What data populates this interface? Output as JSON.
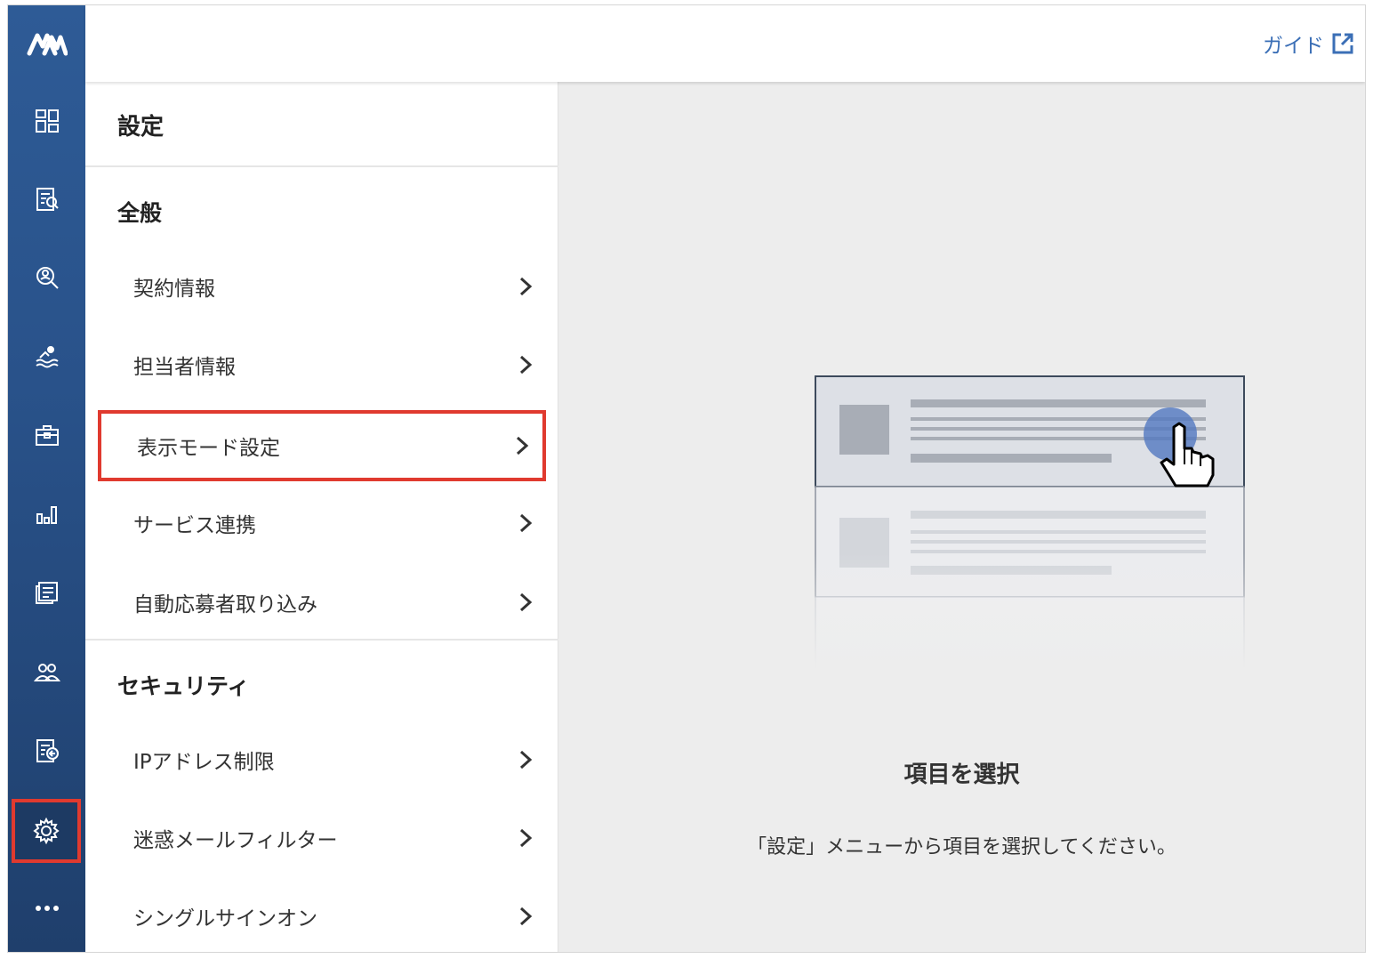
{
  "app": {
    "logo": "M",
    "colors": {
      "rail": "#2c5792",
      "accent": "#3b6fb6",
      "highlight": "#e03a2f"
    }
  },
  "header": {
    "guide_label": "ガイド",
    "guide_icon": "external-link-icon"
  },
  "rail": {
    "icons": [
      "dashboard-icon",
      "document-search-icon",
      "person-search-icon",
      "swimmer-icon",
      "briefcase-icon",
      "bar-chart-icon",
      "report-icon",
      "users-icon",
      "document-share-icon",
      "gear-icon",
      "more-icon"
    ]
  },
  "menu": {
    "title": "設定",
    "sections": [
      {
        "title": "全般",
        "items": [
          {
            "label": "契約情報"
          },
          {
            "label": "担当者情報"
          },
          {
            "label": "表示モード設定"
          },
          {
            "label": "サービス連携"
          },
          {
            "label": "自動応募者取り込み"
          }
        ]
      },
      {
        "title": "セキュリティ",
        "items": [
          {
            "label": "IPアドレス制限"
          },
          {
            "label": "迷惑メールフィルター"
          },
          {
            "label": "シングルサインオン"
          }
        ]
      }
    ]
  },
  "main": {
    "empty_title": "項目を選択",
    "empty_description": "「設定」メニューから項目を選択してください。"
  }
}
